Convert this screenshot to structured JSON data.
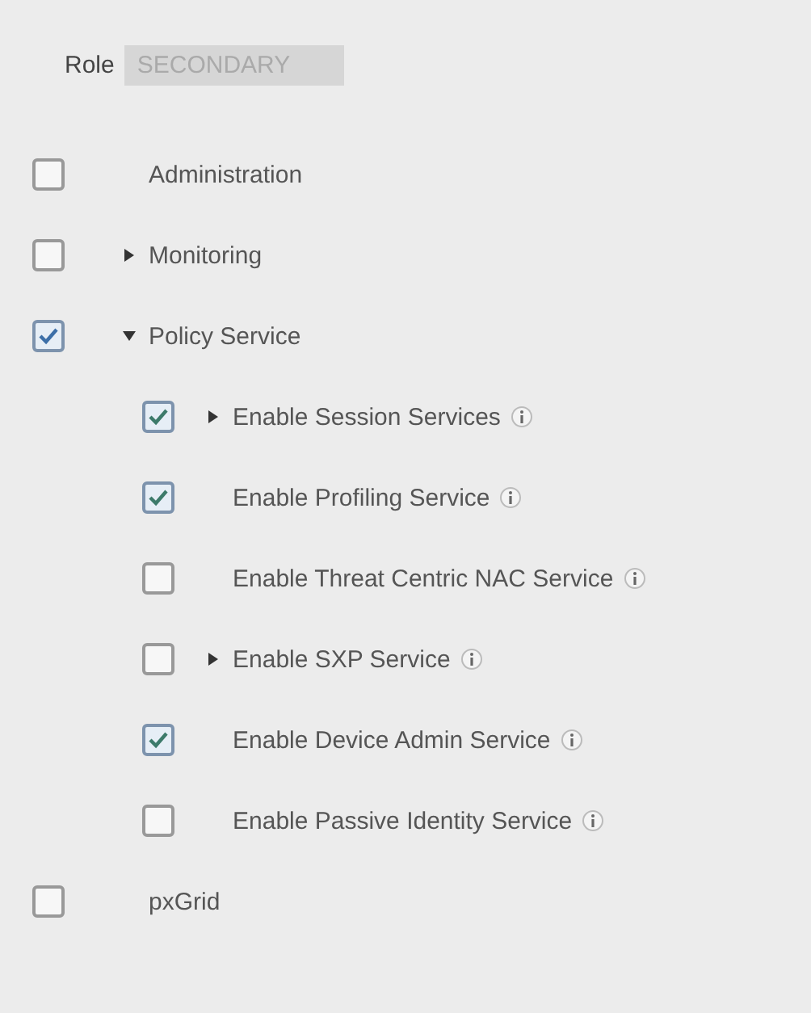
{
  "role": {
    "label": "Role",
    "value": "SECONDARY",
    "disabled": true
  },
  "services": [
    {
      "label": "Administration",
      "checked": false
    },
    {
      "label": "Monitoring",
      "checked": false,
      "expanded": false
    },
    {
      "label": "Policy Service",
      "checked": true,
      "expanded": true,
      "children": [
        {
          "label": "Enable Session Services",
          "checked": true,
          "expanded": false,
          "info": true
        },
        {
          "label": "Enable Profiling Service",
          "checked": true,
          "info": true
        },
        {
          "label": "Enable Threat Centric NAC Service",
          "checked": false,
          "info": true
        },
        {
          "label": "Enable SXP Service",
          "checked": false,
          "expanded": false,
          "info": true
        },
        {
          "label": "Enable Device Admin Service",
          "checked": true,
          "info": true
        },
        {
          "label": "Enable Passive Identity Service",
          "checked": false,
          "info": true
        }
      ]
    },
    {
      "label": "pxGrid",
      "checked": false
    }
  ]
}
